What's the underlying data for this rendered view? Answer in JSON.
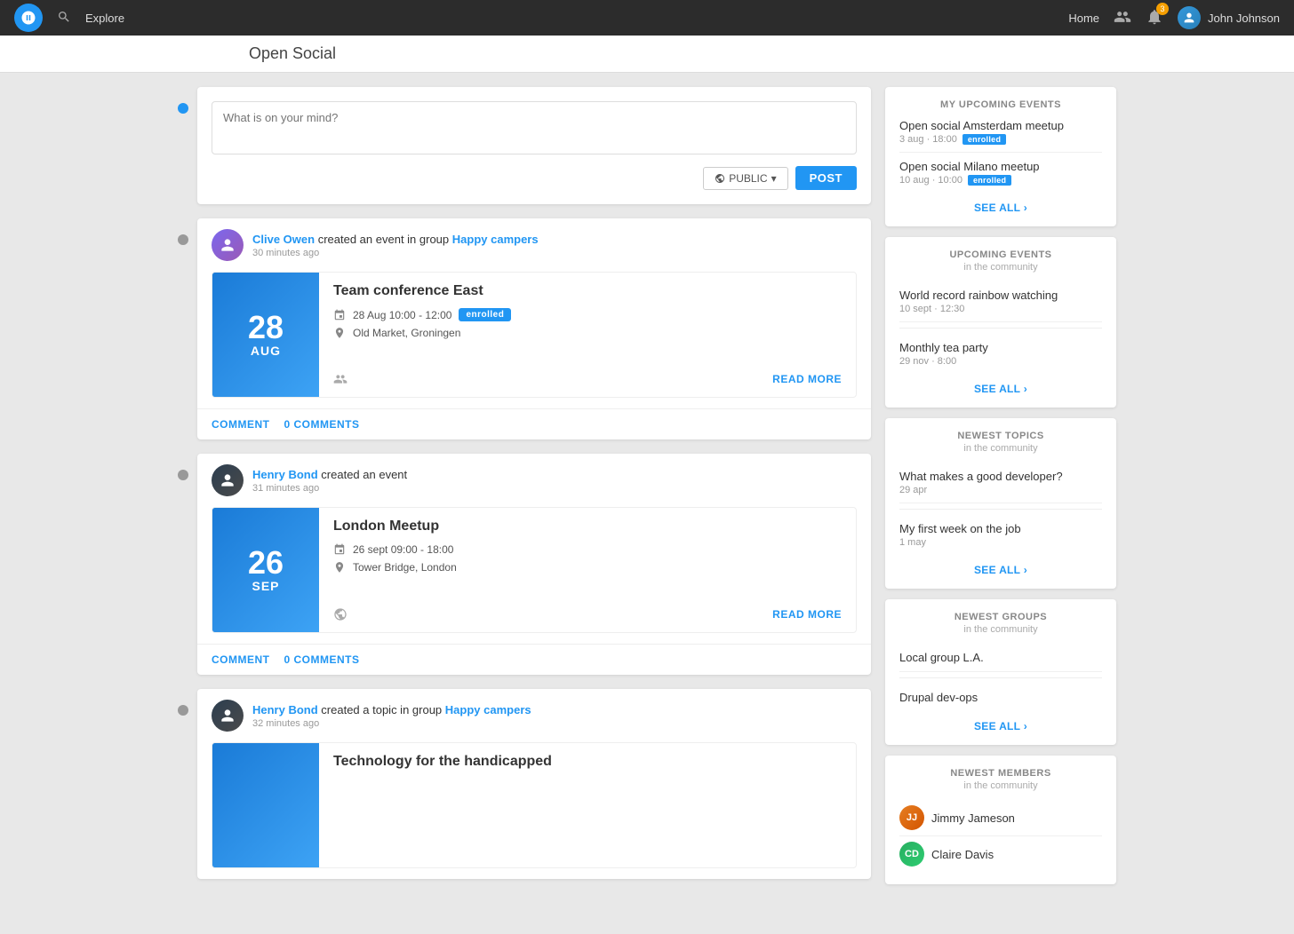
{
  "app": {
    "title": "Open Social",
    "logo_alt": "Open Social logo"
  },
  "topnav": {
    "explore_label": "Explore",
    "home_label": "Home",
    "notifications_count": "3",
    "user_name": "John Johnson"
  },
  "post_box": {
    "placeholder": "What is on your mind?",
    "visibility_label": "PUBLIC",
    "post_button": "POST"
  },
  "feed": [
    {
      "id": "feed-1",
      "author": "Clive Owen",
      "action": "created an event in group",
      "group": "Happy campers",
      "time": "30 minutes ago",
      "event": {
        "title": "Team conference East",
        "day": "28",
        "month": "AUG",
        "date_range": "28 Aug 10:00 - 12:00",
        "enrolled": true,
        "enrolled_label": "enrolled",
        "location": "Old Market, Groningen",
        "read_more": "READ MORE",
        "has_people_icon": true,
        "has_globe_icon": false
      },
      "comment_label": "COMMENT",
      "comments_label": "0 COMMENTS"
    },
    {
      "id": "feed-2",
      "author": "Henry Bond",
      "action": "created an event",
      "group": "",
      "time": "31 minutes ago",
      "event": {
        "title": "London Meetup",
        "day": "26",
        "month": "SEP",
        "date_range": "26 sept 09:00 - 18:00",
        "enrolled": false,
        "enrolled_label": "",
        "location": "Tower Bridge, London",
        "read_more": "READ MORE",
        "has_people_icon": false,
        "has_globe_icon": true
      },
      "comment_label": "COMMENT",
      "comments_label": "0 COMMENTS"
    },
    {
      "id": "feed-3",
      "author": "Henry Bond",
      "action": "created a topic in group",
      "group": "Happy campers",
      "time": "32 minutes ago",
      "event": {
        "title": "Technology for the handicapped",
        "day": "",
        "month": "",
        "date_range": "",
        "enrolled": false,
        "enrolled_label": "",
        "location": "",
        "read_more": "",
        "has_people_icon": false,
        "has_globe_icon": false
      },
      "comment_label": "",
      "comments_label": ""
    }
  ],
  "sidebar": {
    "my_upcoming_events": {
      "title": "MY UPCOMING EVENTS",
      "events": [
        {
          "name": "Open social Amsterdam meetup",
          "meta": "3 aug · 18:00",
          "enrolled": true,
          "enrolled_label": "enrolled"
        },
        {
          "name": "Open social Milano meetup",
          "meta": "10 aug · 10:00",
          "enrolled": true,
          "enrolled_label": "enrolled"
        }
      ],
      "see_all": "SEE ALL ›"
    },
    "upcoming_events": {
      "title": "UPCOMING EVENTS",
      "subtitle": "in the community",
      "events": [
        {
          "name": "World record rainbow watching",
          "meta": "10 sept · 12:30"
        },
        {
          "name": "Monthly tea party",
          "meta": "29 nov · 8:00"
        }
      ],
      "see_all": "SEE ALL ›"
    },
    "newest_topics": {
      "title": "NEWEST TOPICS",
      "subtitle": "in the community",
      "topics": [
        {
          "name": "What makes a good developer?",
          "meta": "29 apr"
        },
        {
          "name": "My first week on the job",
          "meta": "1 may"
        }
      ],
      "see_all": "SEE ALL ›"
    },
    "newest_groups": {
      "title": "NEWEST GROUPS",
      "subtitle": "in the community",
      "groups": [
        {
          "name": "Local group L.A."
        },
        {
          "name": "Drupal dev-ops"
        }
      ],
      "see_all": "SEE ALL ›"
    },
    "newest_members": {
      "title": "NEWEST MEMBERS",
      "subtitle": "in the community",
      "members": [
        {
          "name": "Jimmy Jameson",
          "initials": "JJ",
          "av_class": "av-jimmy"
        },
        {
          "name": "Claire Davis",
          "initials": "CD",
          "av_class": "av-claire"
        }
      ]
    }
  }
}
